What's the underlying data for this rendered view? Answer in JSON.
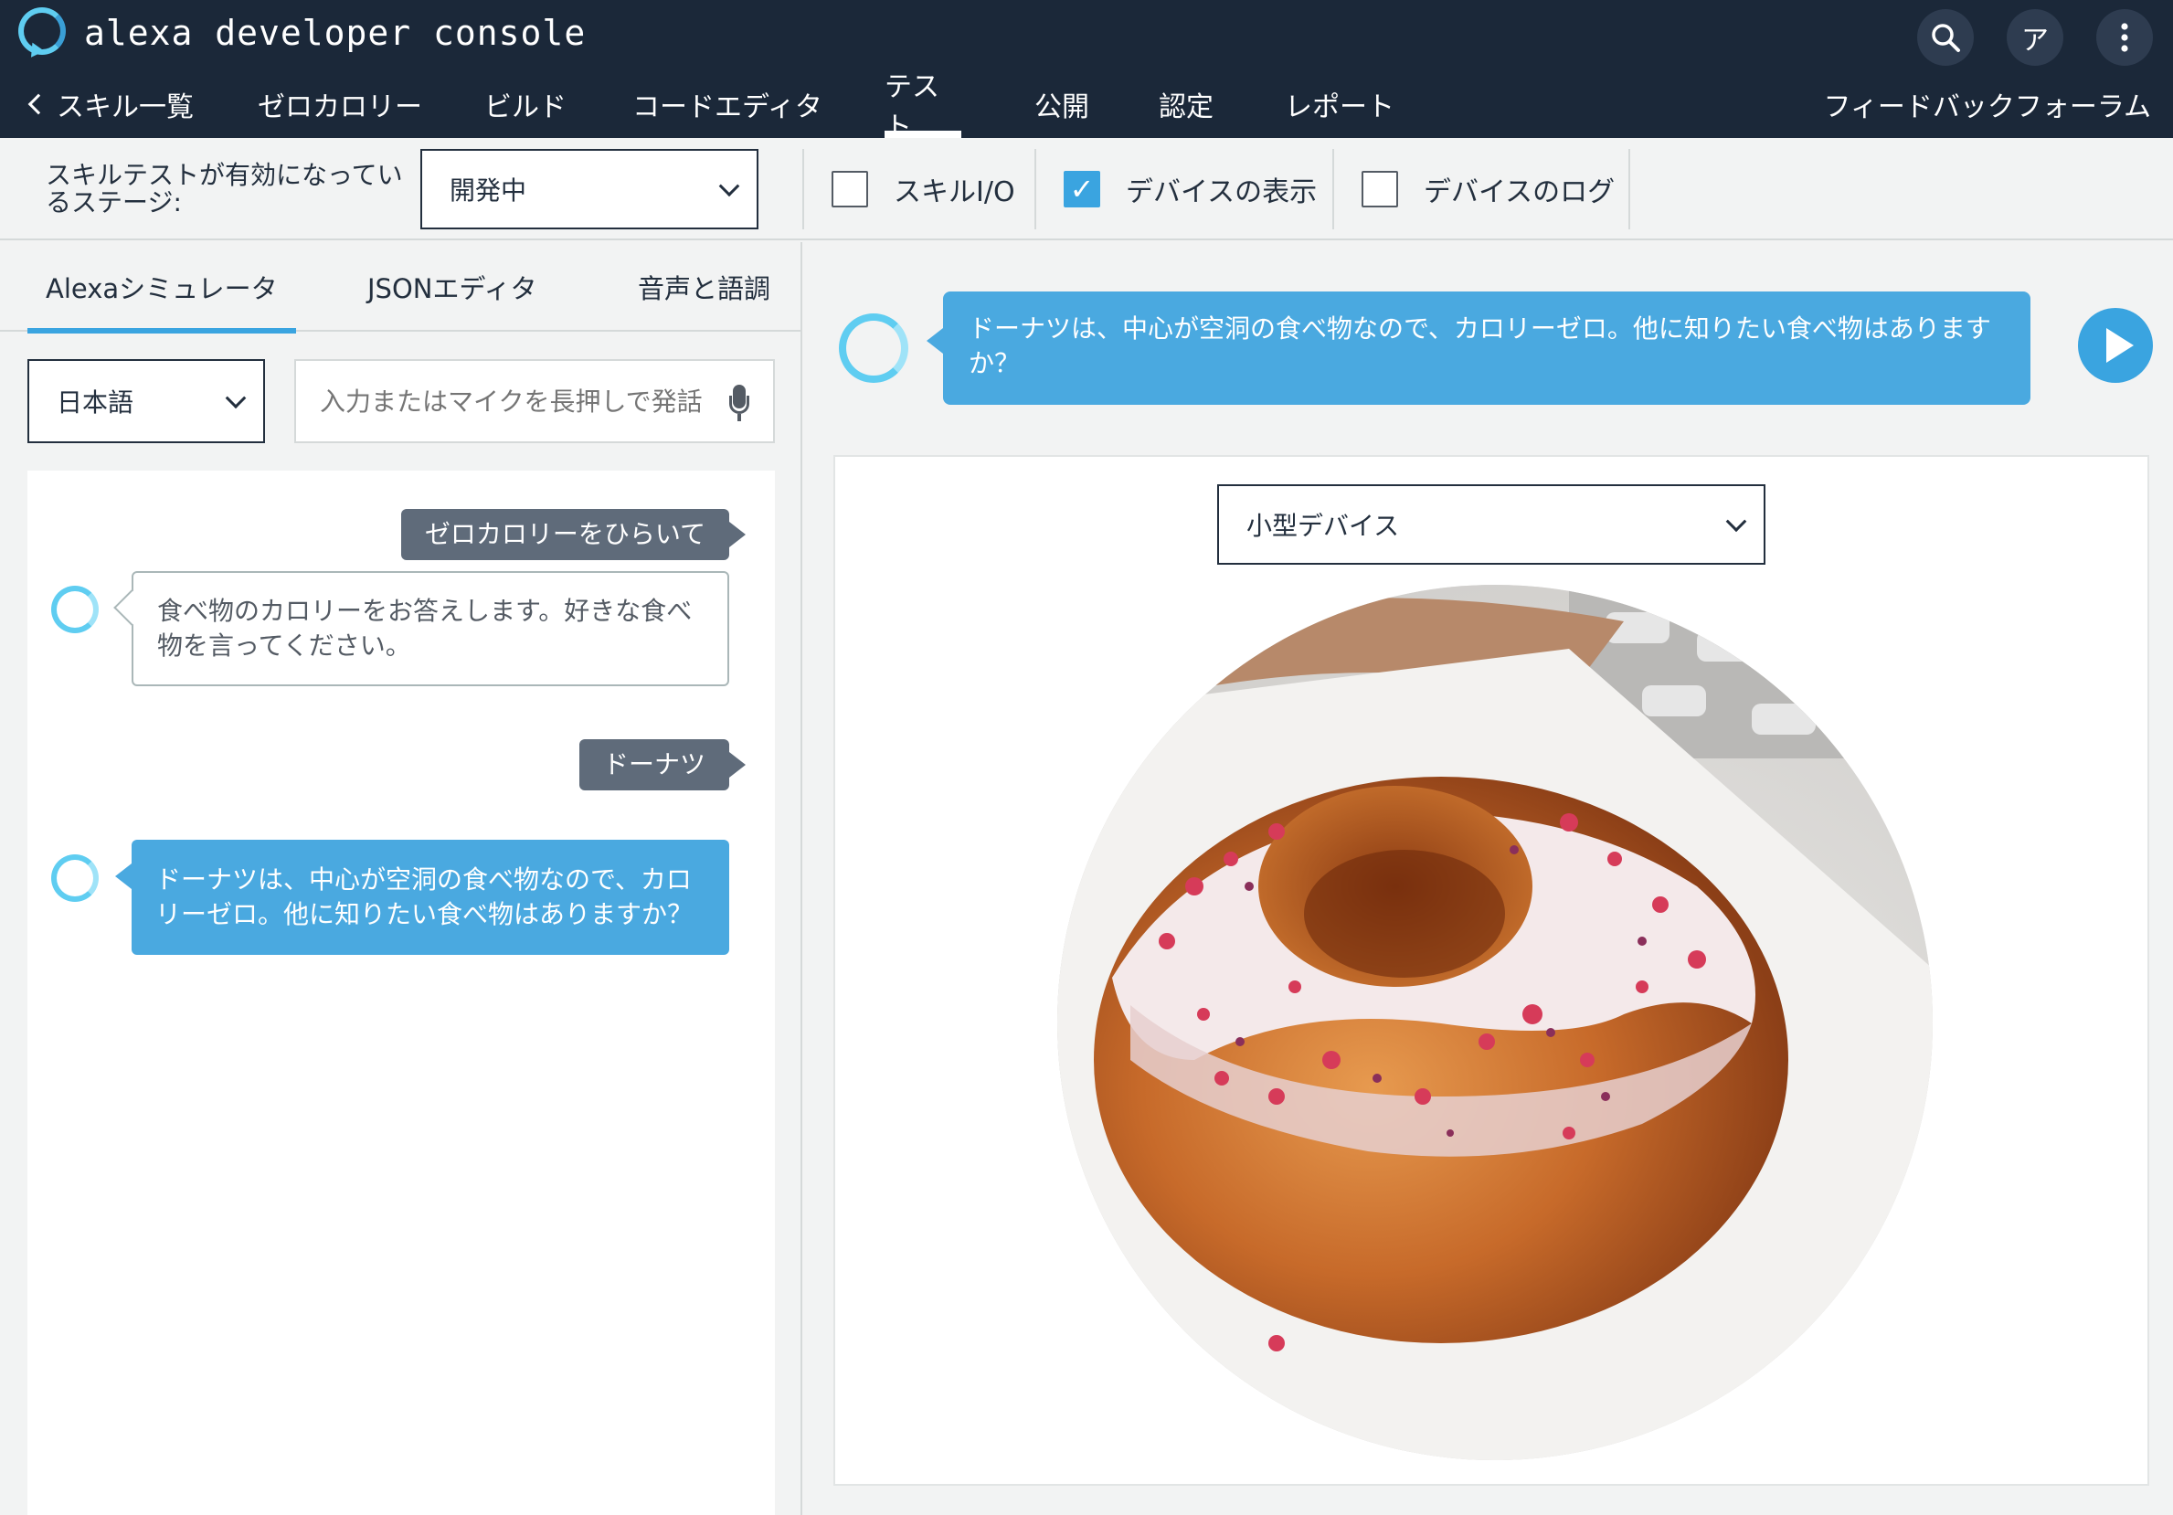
{
  "header": {
    "app_title": "alexa developer console",
    "icons": [
      "search-icon",
      "avatar-icon",
      "more-vertical-icon"
    ],
    "avatar_letter": "ア"
  },
  "nav": {
    "items": [
      {
        "label": "スキル一覧",
        "chevron": "<"
      },
      {
        "label": "ゼロカロリー"
      },
      {
        "label": "ビルド"
      },
      {
        "label": "コードエディタ"
      },
      {
        "label": "テスト",
        "active": true
      },
      {
        "label": "公開"
      },
      {
        "label": "認定"
      },
      {
        "label": "レポート"
      }
    ],
    "feedback": "フィードバックフォーラム"
  },
  "toolbar": {
    "stage_label": "スキルテストが有効になっているステージ:",
    "stage_value": "開発中",
    "checkboxes": [
      {
        "label": "スキルI/O",
        "checked": false
      },
      {
        "label": "デバイスの表示",
        "checked": true
      },
      {
        "label": "デバイスのログ",
        "checked": false
      }
    ]
  },
  "left": {
    "tabs": [
      {
        "label": "Alexaシミュレータ",
        "active": true
      },
      {
        "label": "JSONエディタ"
      },
      {
        "label": "音声と語調"
      }
    ],
    "language": "日本語",
    "input_placeholder": "入力またはマイクを長押しで発話",
    "messages": [
      {
        "from": "user",
        "text": "ゼロカロリーをひらいて"
      },
      {
        "from": "alexa",
        "text": "食べ物のカロリーをお答えします。好きな食べ物を言ってください。"
      },
      {
        "from": "user",
        "text": "ドーナツ"
      },
      {
        "from": "alexa",
        "text": "ドーナツは、中心が空洞の食べ物なので、カロリーゼロ。他に知りたい食べ物はありますか？",
        "highlight": true
      }
    ]
  },
  "right": {
    "response_text": "ドーナツは、中心が空洞の食べ物なので、カロリーゼロ。他に知りたい食べ物はありますか？",
    "device": "小型デバイス"
  },
  "colors": {
    "header_bg": "#1b2839",
    "accent": "#3aa4e0",
    "alexa_ring": "#5fcdf1",
    "user_bubble": "#5f6b7a"
  }
}
